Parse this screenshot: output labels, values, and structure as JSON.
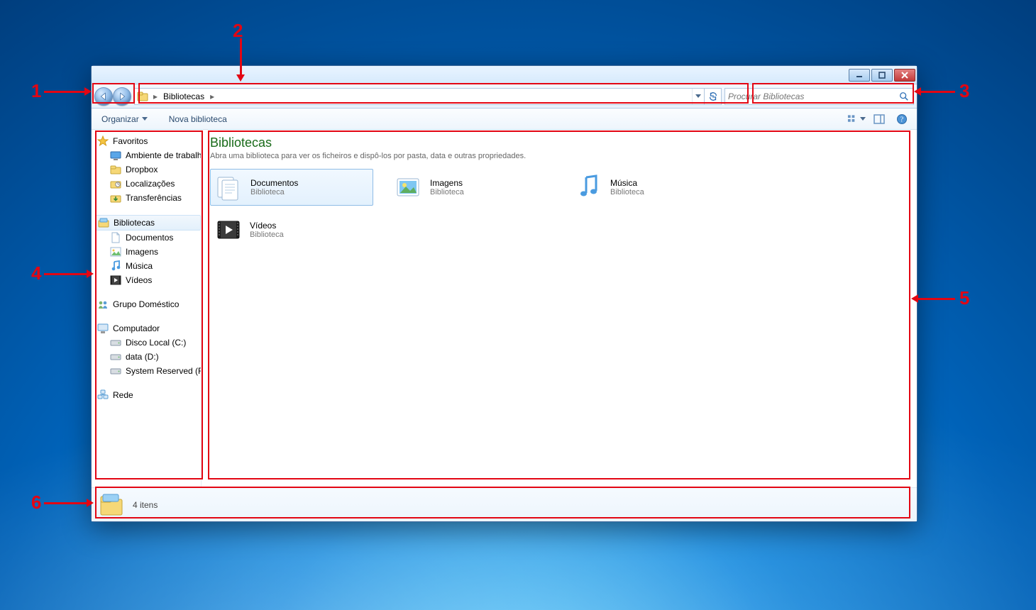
{
  "annotations": {
    "a1": "1",
    "a2": "2",
    "a3": "3",
    "a4": "4",
    "a5": "5",
    "a6": "6"
  },
  "addressbar": {
    "root_sep": "▸",
    "crumb1": "Bibliotecas",
    "crumb1_sep": "▸"
  },
  "search": {
    "placeholder": "Procurar Bibliotecas"
  },
  "commandbar": {
    "organize": "Organizar",
    "newlibrary": "Nova biblioteca"
  },
  "nav": {
    "favorites": {
      "label": "Favoritos",
      "items": [
        "Ambiente de trabalh",
        "Dropbox",
        "Localizações",
        "Transferências"
      ]
    },
    "libraries": {
      "label": "Bibliotecas",
      "items": [
        "Documentos",
        "Imagens",
        "Música",
        "Vídeos"
      ]
    },
    "homegroup": {
      "label": "Grupo Doméstico"
    },
    "computer": {
      "label": "Computador",
      "items": [
        "Disco Local (C:)",
        "data (D:)",
        "System Reserved (F:)"
      ]
    },
    "network": {
      "label": "Rede"
    }
  },
  "content": {
    "title": "Bibliotecas",
    "subtitle": "Abra uma biblioteca para ver os ficheiros e dispô-los por pasta, data e outras propriedades.",
    "kind_label": "Biblioteca",
    "items": [
      {
        "name": "Documentos"
      },
      {
        "name": "Imagens"
      },
      {
        "name": "Música"
      },
      {
        "name": "Vídeos"
      }
    ]
  },
  "details": {
    "status": "4 itens"
  }
}
